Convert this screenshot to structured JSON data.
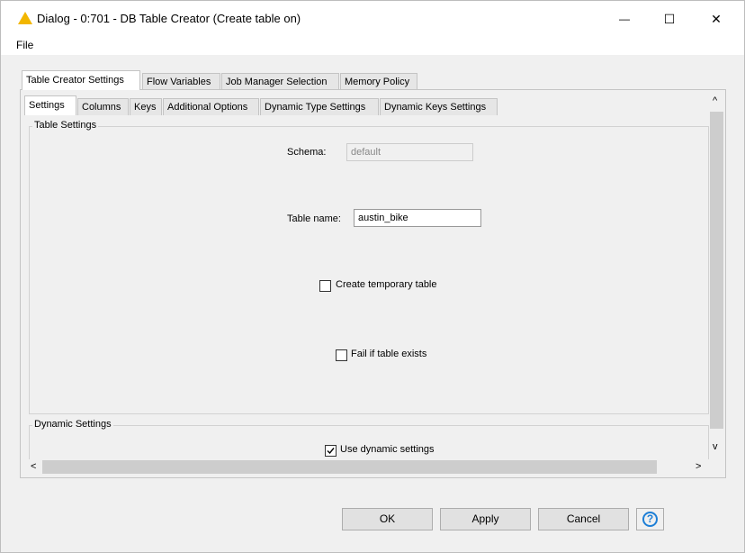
{
  "window": {
    "title": "Dialog - 0:701 - DB Table Creator (Create table on)",
    "minimize": "—",
    "maximize": "☐",
    "close": "✕"
  },
  "menu": {
    "file": "File"
  },
  "outer_tabs": [
    "Table Creator Settings",
    "Flow Variables",
    "Job Manager Selection",
    "Memory Policy"
  ],
  "inner_tabs": [
    "Settings",
    "Columns",
    "Keys",
    "Additional Options",
    "Dynamic Type Settings",
    "Dynamic Keys Settings"
  ],
  "table_settings": {
    "group_label": "Table Settings",
    "schema_label": "Schema:",
    "schema_value": "default",
    "table_name_label": "Table name:",
    "table_name_value": "austin_bike",
    "create_temp_label": "Create temporary table",
    "create_temp_checked": false,
    "fail_if_exists_label": "Fail if table exists",
    "fail_if_exists_checked": false
  },
  "dynamic_settings": {
    "group_label": "Dynamic Settings",
    "use_dynamic_label": "Use dynamic settings",
    "use_dynamic_checked": true
  },
  "scroll": {
    "up": "^",
    "down": "v",
    "left": "<",
    "right": ">"
  },
  "buttons": {
    "ok": "OK",
    "apply": "Apply",
    "cancel": "Cancel",
    "help": "?"
  },
  "colors": {
    "warning": "#f2b600",
    "help": "#1e7fd6"
  }
}
